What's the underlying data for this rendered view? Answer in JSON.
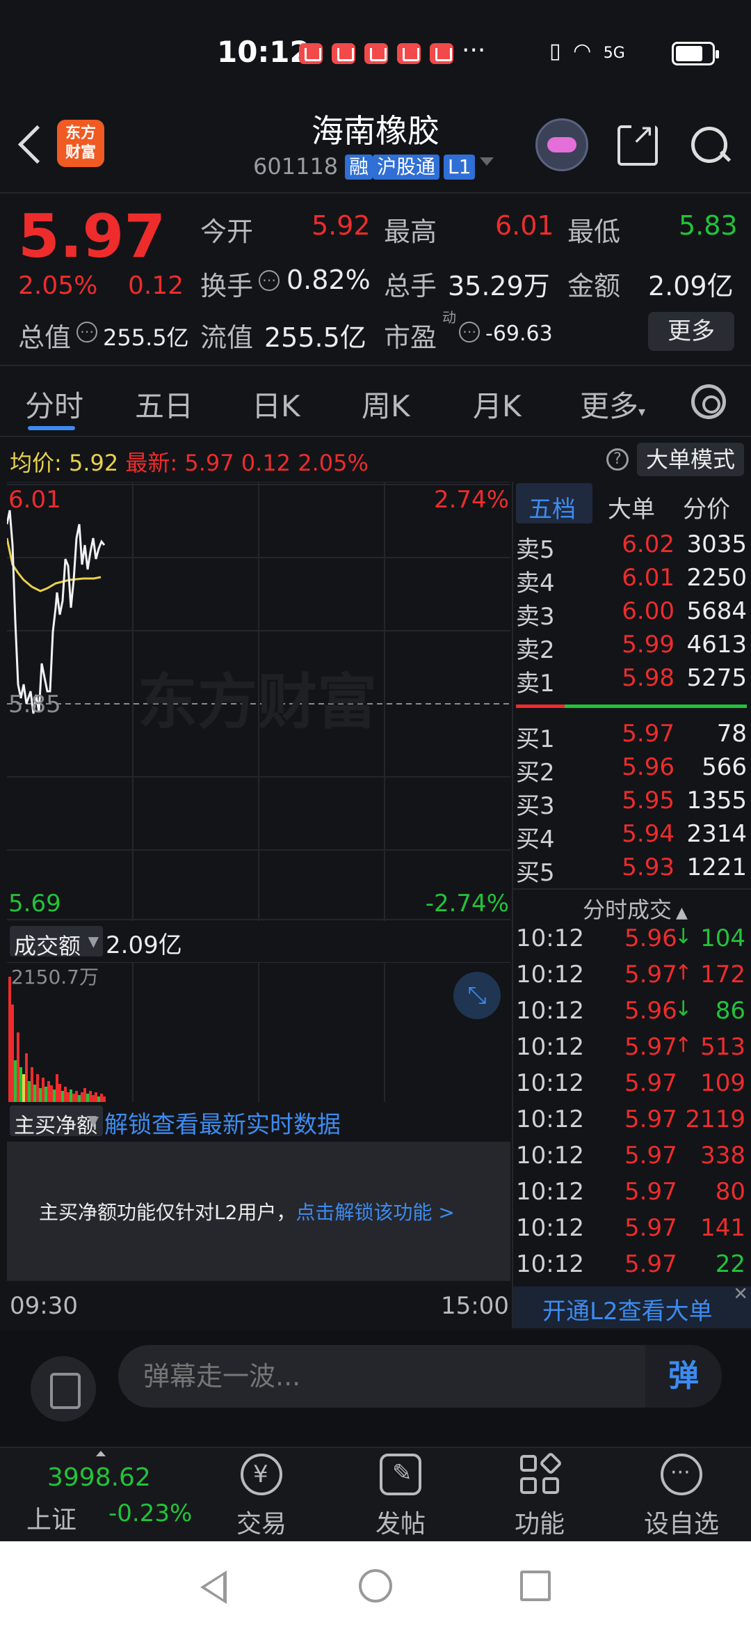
{
  "status_bar": {
    "time": "10:12",
    "dots": "···",
    "icons_text": "5G"
  },
  "header": {
    "logo_text_1": "东方",
    "logo_text_2": "财富",
    "stock_name": "海南橡胶",
    "stock_code": "601118",
    "tags": [
      "融",
      "沪股通",
      "L1"
    ]
  },
  "quote": {
    "price": "5.97",
    "change_pct": "2.05%",
    "change": "0.12",
    "open_label": "今开",
    "open": "5.92",
    "high_label": "最高",
    "high": "6.01",
    "low_label": "最低",
    "low": "5.83",
    "turnover_label": "换手",
    "turnover": "0.82%",
    "volume_label": "总手",
    "volume": "35.29万",
    "amount_label": "金额",
    "amount": "2.09亿",
    "mktcap_label": "总值",
    "mktcap": "255.5亿",
    "float_label": "流值",
    "float": "255.5亿",
    "pe_label": "市盈",
    "pe_sup": "动",
    "pe": "-69.63",
    "more_button": "更多"
  },
  "tabs": [
    "分时",
    "五日",
    "日K",
    "周K",
    "月K",
    "更多"
  ],
  "info_line": {
    "avg_label": "均价:",
    "avg": "5.92",
    "latest_label": "最新:",
    "latest": "5.97",
    "latest_change": "0.12",
    "latest_pct": "2.05%",
    "help_icon": "?",
    "big_order_button": "大单模式"
  },
  "chart": {
    "top_left": "6.01",
    "top_right": "2.74%",
    "mid_left": "5.85",
    "bottom_left": "5.69",
    "bottom_right": "-2.74%",
    "watermark": "东方财富",
    "colors": {
      "price_line": "#ffffff",
      "avg_line": "#e8d24a",
      "up": "#ee2c2c",
      "down": "#22c33a"
    }
  },
  "volume_panel": {
    "selector": "成交额",
    "value": "2.09亿",
    "max_label": "2150.7万"
  },
  "netbuy_panel": {
    "selector": "主买净额",
    "unlock_link": "解锁查看最新实时数据",
    "lock_text": "主买净额功能仅针对L2用户，",
    "lock_link": "点击解锁该功能 >"
  },
  "time_axis": {
    "start": "09:30",
    "end": "15:00"
  },
  "orderbook": {
    "tabs": [
      "五档",
      "大单",
      "分价"
    ],
    "asks": [
      {
        "label": "卖5",
        "price": "6.02",
        "vol": "3035"
      },
      {
        "label": "卖4",
        "price": "6.01",
        "vol": "2250"
      },
      {
        "label": "卖3",
        "price": "6.00",
        "vol": "5684"
      },
      {
        "label": "卖2",
        "price": "5.99",
        "vol": "4613"
      },
      {
        "label": "卖1",
        "price": "5.98",
        "vol": "5275"
      }
    ],
    "bids": [
      {
        "label": "买1",
        "price": "5.97",
        "vol": "78"
      },
      {
        "label": "买2",
        "price": "5.96",
        "vol": "566"
      },
      {
        "label": "买3",
        "price": "5.95",
        "vol": "1355"
      },
      {
        "label": "买4",
        "price": "5.94",
        "vol": "2314"
      },
      {
        "label": "买5",
        "price": "5.93",
        "vol": "1221"
      }
    ],
    "ticks_title": "分时成交",
    "ticks": [
      {
        "time": "10:12",
        "price": "5.96",
        "arrow": "↓",
        "vol": "104",
        "dir": "down"
      },
      {
        "time": "10:12",
        "price": "5.97",
        "arrow": "↑",
        "vol": "172",
        "dir": "up"
      },
      {
        "time": "10:12",
        "price": "5.96",
        "arrow": "↓",
        "vol": "86",
        "dir": "down"
      },
      {
        "time": "10:12",
        "price": "5.97",
        "arrow": "↑",
        "vol": "513",
        "dir": "up"
      },
      {
        "time": "10:12",
        "price": "5.97",
        "arrow": "",
        "vol": "109",
        "dir": "up"
      },
      {
        "time": "10:12",
        "price": "5.97",
        "arrow": "",
        "vol": "2119",
        "dir": "up"
      },
      {
        "time": "10:12",
        "price": "5.97",
        "arrow": "",
        "vol": "338",
        "dir": "up"
      },
      {
        "time": "10:12",
        "price": "5.97",
        "arrow": "",
        "vol": "80",
        "dir": "up"
      },
      {
        "time": "10:12",
        "price": "5.97",
        "arrow": "",
        "vol": "141",
        "dir": "up"
      },
      {
        "time": "10:12",
        "price": "5.97",
        "arrow": "",
        "vol": "22",
        "dir": "down"
      }
    ],
    "l2_link": "开通L2查看大单",
    "l2_close": "✕"
  },
  "danmu": {
    "placeholder": "弹幕走一波...",
    "button": "弹"
  },
  "bottom_nav": {
    "index_value": "3998.62",
    "index_name": "上证",
    "index_change": "-0.23%",
    "items": [
      "交易",
      "发帖",
      "功能",
      "设自选"
    ]
  }
}
